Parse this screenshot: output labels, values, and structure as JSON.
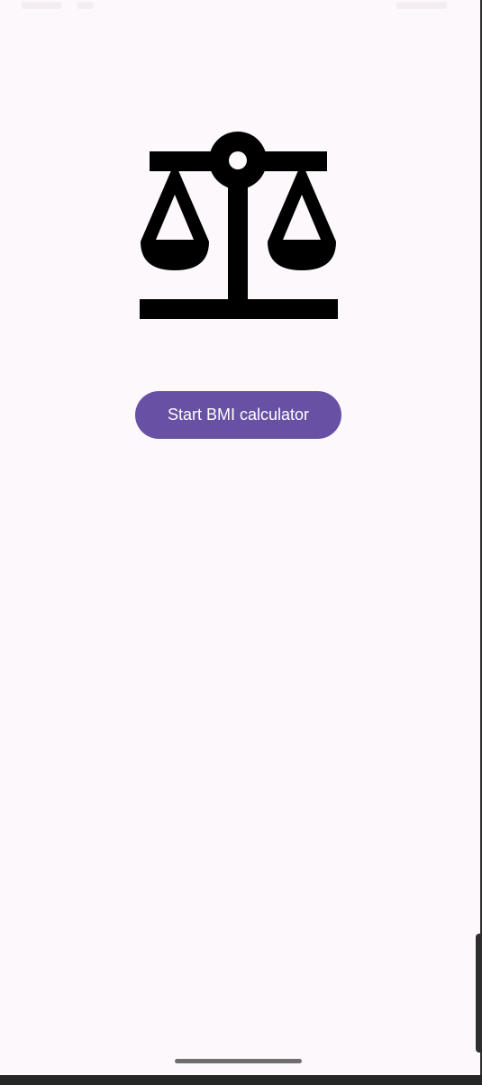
{
  "app": {
    "icon_name": "scale-balance-icon",
    "start_button_label": "Start BMI calculator"
  },
  "colors": {
    "background": "#fdf8fc",
    "primary": "#6851a5",
    "on_primary": "#ffffff",
    "icon": "#000000"
  }
}
